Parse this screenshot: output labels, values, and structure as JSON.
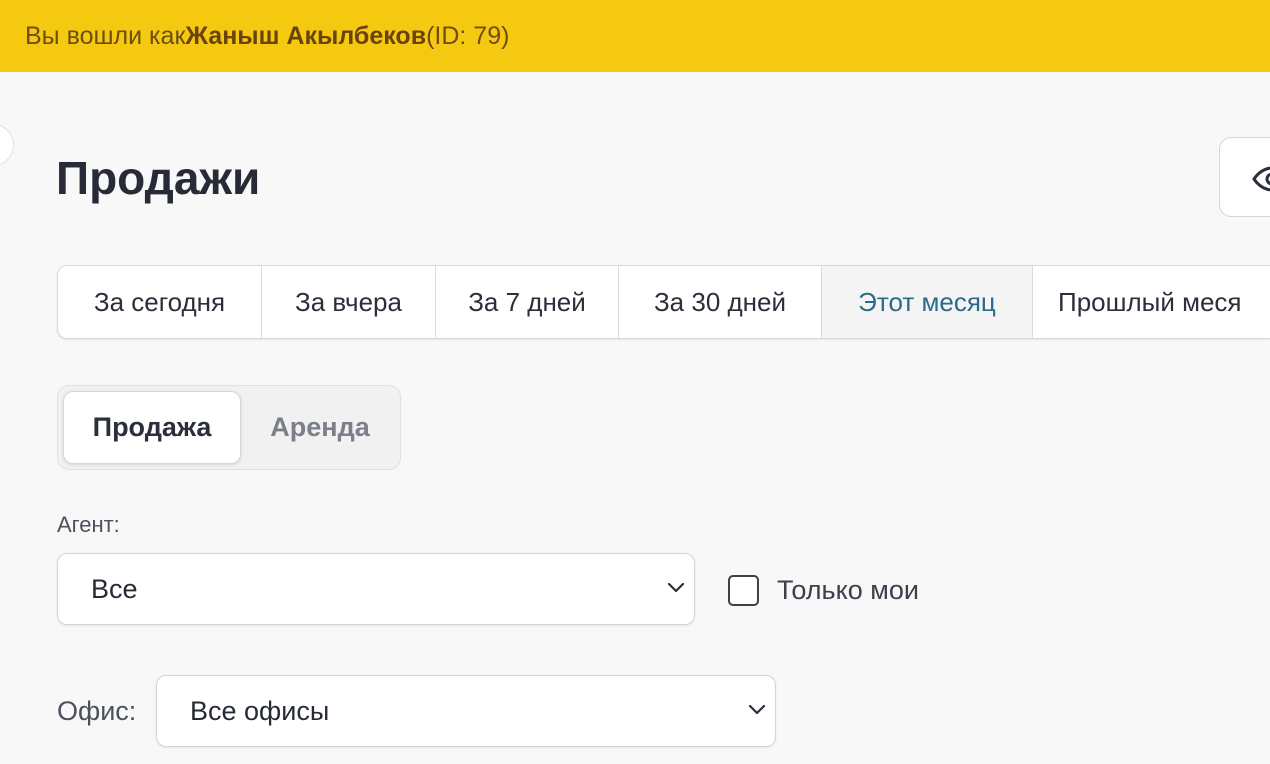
{
  "banner": {
    "prefix": "Вы вошли как ",
    "user_name": "Жаныш Акылбеков",
    "suffix": " (ID: 79)"
  },
  "page": {
    "title": "Продажи",
    "view_button_icon": "eye-icon"
  },
  "period_tabs": [
    {
      "label": "За сегодня",
      "active": false
    },
    {
      "label": "За вчера",
      "active": false
    },
    {
      "label": "За 7 дней",
      "active": false
    },
    {
      "label": "За 30 дней",
      "active": false
    },
    {
      "label": "Этот месяц",
      "active": true
    },
    {
      "label": "Прошлый меся",
      "active": false
    }
  ],
  "deal_type": {
    "options": [
      "Продажа",
      "Аренда"
    ],
    "selected": "Продажа"
  },
  "filters": {
    "agent_label": "Агент:",
    "agent_value": "Все",
    "only_mine_label": "Только мои",
    "only_mine_checked": false,
    "office_label": "Офис:",
    "office_value": "Все офисы"
  },
  "colors": {
    "banner_bg": "#f5c90f",
    "active_tab_text": "#2c6b88"
  }
}
